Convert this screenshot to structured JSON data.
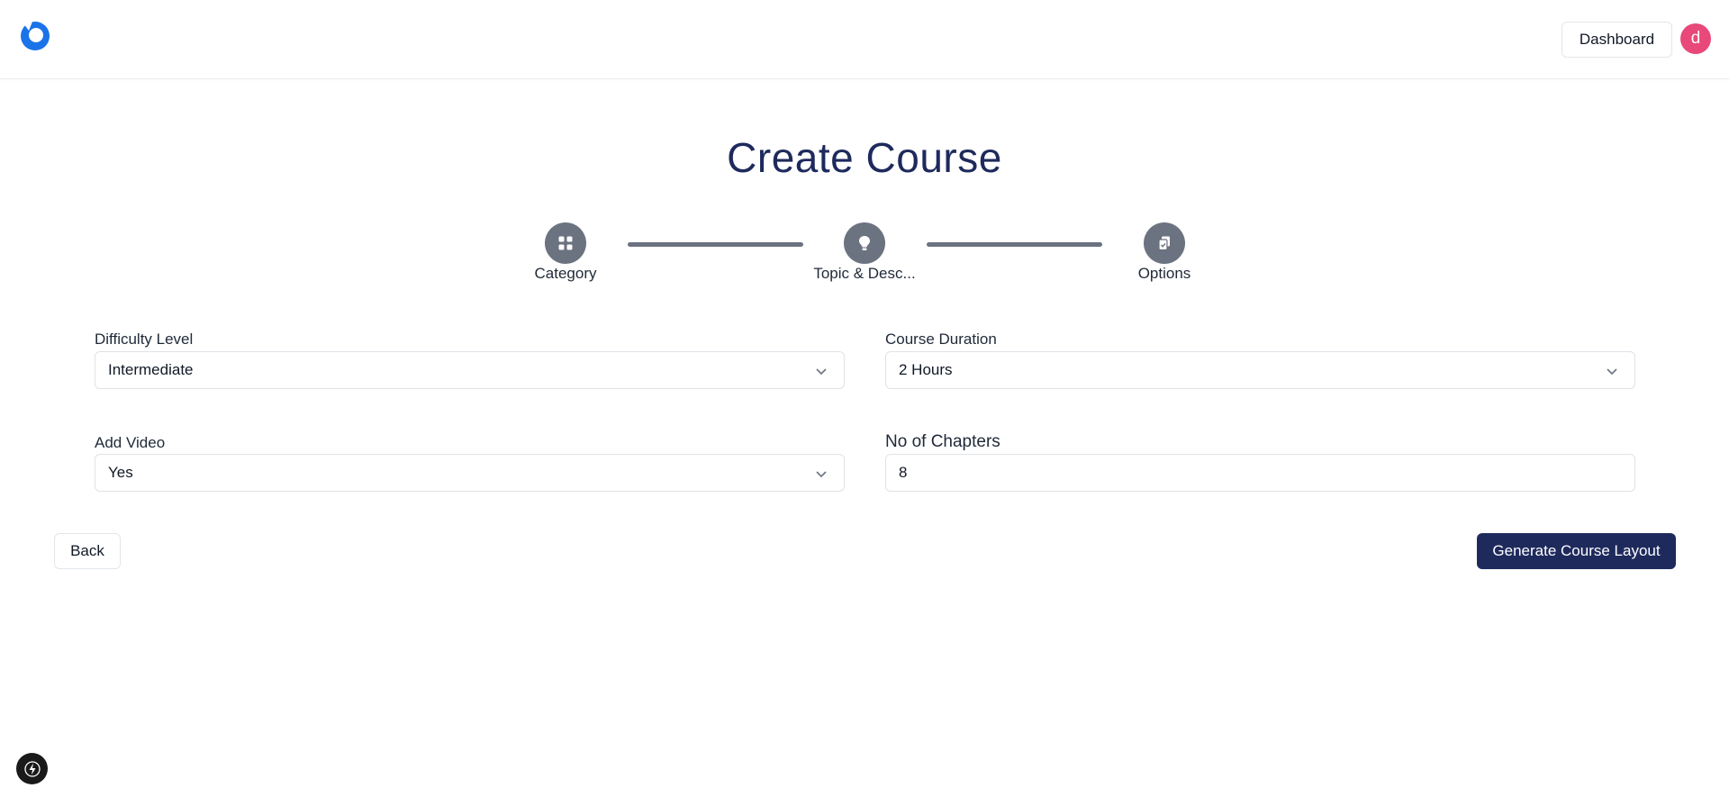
{
  "header": {
    "logo_icon": "logo-icon",
    "dashboard_label": "Dashboard",
    "avatar_initial": "d",
    "avatar_color": "#e8487a"
  },
  "page": {
    "title": "Create Course"
  },
  "stepper": {
    "steps": [
      {
        "label": "Category",
        "icon": "grid-icon"
      },
      {
        "label": "Topic & Desc...",
        "icon": "lightbulb-icon"
      },
      {
        "label": "Options",
        "icon": "clipboard-icon"
      }
    ],
    "color": "#6b7280"
  },
  "form": {
    "difficulty": {
      "label": "Difficulty Level",
      "value": "Intermediate"
    },
    "duration": {
      "label": "Course Duration",
      "value": "2 Hours"
    },
    "video": {
      "label": "Add Video",
      "value": "Yes"
    },
    "chapters": {
      "label": "No of Chapters",
      "value": "8"
    }
  },
  "actions": {
    "back_label": "Back",
    "generate_label": "Generate Course Layout",
    "primary_color": "#1e2a5c"
  },
  "floating": {
    "icon": "bolt-icon"
  }
}
